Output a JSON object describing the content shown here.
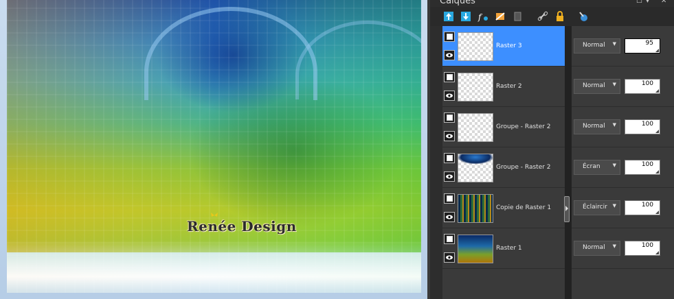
{
  "panel": {
    "title": "Calques"
  },
  "canvas": {
    "watermark": "Renée Design"
  },
  "toolbar": {
    "tools": [
      "new-raster-layer-icon",
      "new-vector-layer-icon",
      "new-effect-layer-icon",
      "mask-icon",
      "duplicate-icon",
      "link-icon",
      "lock-icon",
      "paint-icon"
    ]
  },
  "layers": [
    {
      "name": "Raster 3",
      "blend_mode": "Normal",
      "opacity": "95",
      "selected": true
    },
    {
      "name": "Raster 2",
      "blend_mode": "Normal",
      "opacity": "100",
      "selected": false
    },
    {
      "name": "Groupe - Raster 2",
      "blend_mode": "Normal",
      "opacity": "100",
      "selected": false
    },
    {
      "name": "Groupe - Raster 2",
      "blend_mode": "Écran",
      "opacity": "100",
      "selected": false
    },
    {
      "name": "Copie de Raster 1",
      "blend_mode": "Éclaircir",
      "opacity": "100",
      "selected": false
    },
    {
      "name": "Raster 1",
      "blend_mode": "Normal",
      "opacity": "100",
      "selected": false
    }
  ],
  "colors": {
    "selection": "#3d8fff",
    "panel_bg": "#2d2d2d",
    "row_bg": "#3a3a3a"
  }
}
